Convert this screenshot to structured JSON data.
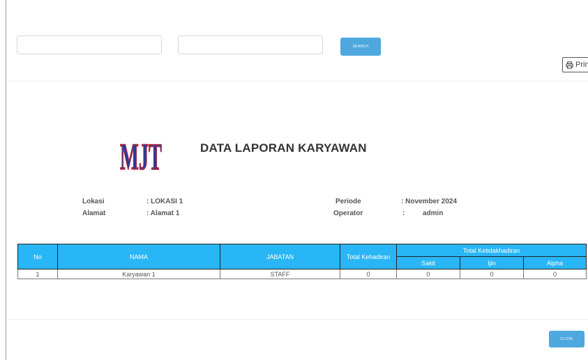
{
  "filters": {
    "field1": {
      "value": "",
      "placeholder": ""
    },
    "field2": {
      "value": "",
      "placeholder": ""
    },
    "search_label": "SEARCH"
  },
  "print_label": "Print",
  "logo_text": "MJT",
  "report": {
    "title": "DATA LAPORAN KARYAWAN",
    "info": {
      "lokasi_label": "Lokasi",
      "lokasi_value": ": LOKASI 1",
      "alamat_label": "Alamat",
      "alamat_value": ": Alamat 1",
      "periode_label": "Periode",
      "periode_value": ": November 2024",
      "operator_label": "Operator",
      "operator_sep": ":",
      "operator_value": "admin"
    },
    "table": {
      "headers": {
        "no": "No",
        "nama": "NAMA",
        "jabatan": "JABATAN",
        "total_kehadiran": "Total Kehadiran",
        "total_ketidakhadiran": "Total Ketidakhadiran",
        "sakit": "Sakit",
        "ijin": "Ijin",
        "alpha": "Alpha"
      },
      "rows": [
        {
          "no": "1",
          "nama": "Karyawan 1",
          "jabatan": "STAFF",
          "kehadiran": "0",
          "sakit": "0",
          "ijin": "0",
          "alpha": "0"
        }
      ]
    }
  },
  "close_label": "CLOSE",
  "colors": {
    "accent": "#4ea8de",
    "table_header": "#29b6f6",
    "logo_fill": "#1f3f9a",
    "logo_outline": "#d1253b"
  }
}
